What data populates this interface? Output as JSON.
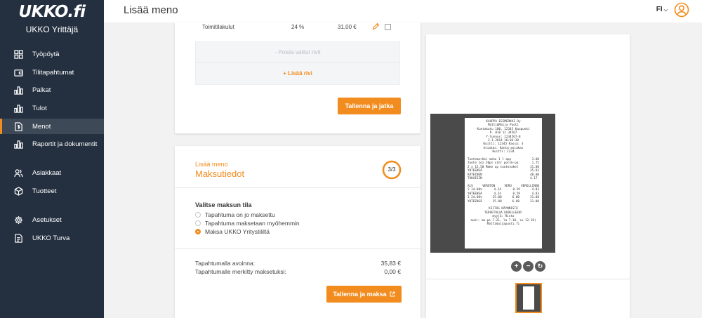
{
  "app": {
    "logo": "UKKO.fi",
    "subtitle": "UKKO Yrittäjä"
  },
  "sidebar": {
    "items": [
      {
        "label": "Työpöytä",
        "icon": "grid-icon"
      },
      {
        "label": "Tilitapahtumat",
        "icon": "wallet-icon"
      },
      {
        "label": "Palkat",
        "icon": "bar-chart-icon"
      },
      {
        "label": "Tulot",
        "icon": "bar-chart-icon"
      },
      {
        "label": "Menot",
        "icon": "dollar-document-icon",
        "active": true
      },
      {
        "label": "Raportit ja dokumentit",
        "icon": "bar-chart-icon"
      },
      {
        "label": "Asiakkaat",
        "icon": "users-icon"
      },
      {
        "label": "Tuotteet",
        "icon": "box-icon"
      },
      {
        "label": "Asetukset",
        "icon": "gear-icon"
      },
      {
        "label": "UKKO Turva",
        "icon": "document-icon"
      }
    ]
  },
  "header": {
    "title": "Lisää meno",
    "language": "FI",
    "user_icon": "user-circle-icon"
  },
  "expense_rows": {
    "row": {
      "name": "Toimitilakulut",
      "vat": "24 %",
      "amount": "31,00 €"
    },
    "remove_rows": "- Poista valitut rivit",
    "add_row": "+ Lisää rivi",
    "save_continue": "Tallenna ja jatka"
  },
  "payment": {
    "label": "Lisää meno",
    "title": "Maksutiedot",
    "step": "3/3",
    "step_progress": 1.0,
    "section_heading": "Valitse maksun tila",
    "options": [
      {
        "label": "Tapahtuma on jo maksettu",
        "checked": false
      },
      {
        "label": "Tapahtuma maksetaan myöhemmin",
        "checked": false
      },
      {
        "label": "Maksa UKKO Yritystililtä",
        "checked": true
      }
    ],
    "open_label": "Tapahtumalla avoinna:",
    "open_amount": "35,83 €",
    "marked_label": "Tapahtumalle merkitty maksetuksi:",
    "marked_amount": "0,00 €",
    "save_pay": "Tallenna ja maksa"
  },
  "receipt": {
    "header_lines": [
      "KAUPPA ESIMERKKI Oy",
      "Matti&Maija Puoti",
      "Kuntakatu 100, 12345 Kaupunki",
      "P. 010 12 34567",
      "Y-tunnus: 1234567-8",
      "2.1.2014 16:04:38",
      "Kuitti: 12345 Kassa: 3",
      "Asiakas: Kanta-asiakas",
      "Kuitti: 1234"
    ],
    "items": [
      {
        "name": "Tuotemerkki mehu 1 l app",
        "price": "3.08"
      },
      {
        "name": "Tuote 1oz 20ps vihr porsk-pa",
        "price": "1.75"
      },
      {
        "name": "2 x 15,50 Make up tuotevakel",
        "price": "31.00"
      }
    ],
    "totals": [
      {
        "label": "YHTEENSÄ",
        "value": "35.83"
      },
      {
        "label": "KÄTEINEN",
        "value": "40.00"
      },
      {
        "label": "TAKAISIN",
        "value": "4.17-"
      }
    ],
    "vat_header": [
      "ALV",
      "VEROTON",
      "VERO",
      "VEROLLINEN"
    ],
    "vat_rows": [
      [
        "2 14.00%",
        "4.24",
        "0.59",
        "4.83"
      ],
      [
        "YHTEENSÄ",
        "4.24",
        "0.59",
        "4.83"
      ],
      [
        "3 24.00%",
        "25.00",
        "6.00",
        "31.00"
      ],
      [
        "YHTEENSÄ",
        "25.00",
        "6.00",
        "31.00"
      ]
    ],
    "footer_lines": [
      "KIITOS KÄYNNISTÄ",
      "TERVETULOA UUDELLEEN!",
      "myyjä: Risto",
      "auki: ma-pe 7-21, la 7-18, su 12-18)",
      "Mattimaijapuoti.fi"
    ]
  },
  "viewer": {
    "zoom_in": "+",
    "zoom_out": "−",
    "reset": "↻"
  },
  "colors": {
    "accent": "#f28c1e",
    "sidebar_bg": "#243040",
    "sidebar_active": "#3d4957"
  }
}
